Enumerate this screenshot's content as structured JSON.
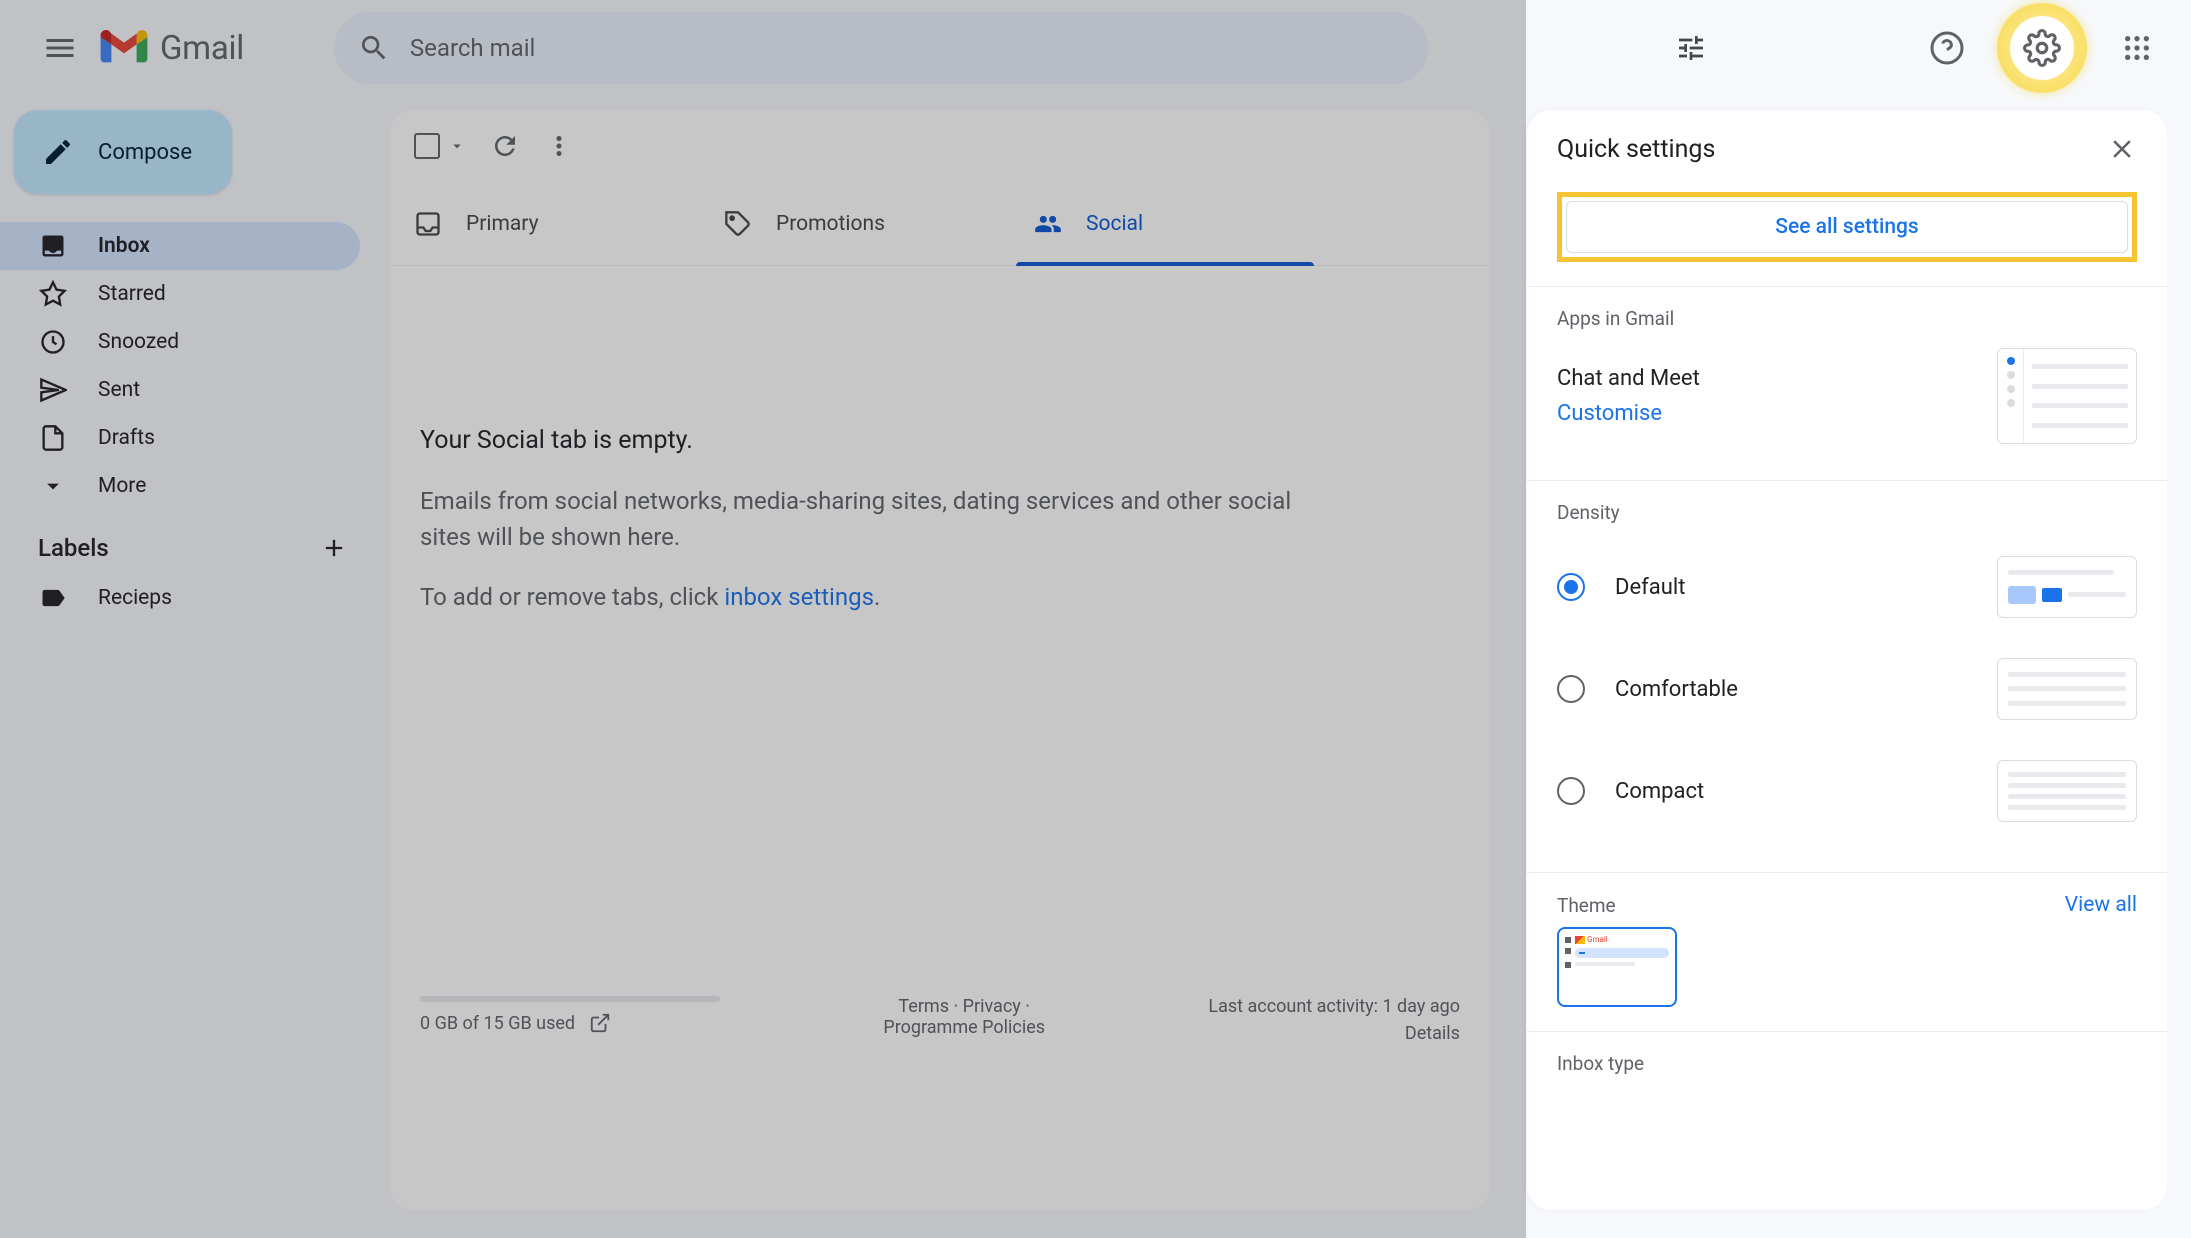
{
  "app": {
    "name": "Gmail"
  },
  "search": {
    "placeholder": "Search mail"
  },
  "compose": {
    "label": "Compose"
  },
  "sidebar": {
    "items": [
      {
        "label": "Inbox",
        "icon": "inbox-icon",
        "active": true
      },
      {
        "label": "Starred",
        "icon": "star-icon"
      },
      {
        "label": "Snoozed",
        "icon": "clock-icon"
      },
      {
        "label": "Sent",
        "icon": "send-icon"
      },
      {
        "label": "Drafts",
        "icon": "file-icon"
      },
      {
        "label": "More",
        "icon": "chevron-down-icon"
      }
    ],
    "labels_header": "Labels",
    "labels": [
      {
        "label": "Recieps",
        "icon": "tag-icon"
      }
    ]
  },
  "tabs": [
    {
      "label": "Primary",
      "icon": "inbox-icon"
    },
    {
      "label": "Promotions",
      "icon": "tag-icon"
    },
    {
      "label": "Social",
      "icon": "people-icon",
      "active": true
    }
  ],
  "empty": {
    "title": "Your Social tab is empty.",
    "desc": "Emails from social networks, media-sharing sites, dating services and other social sites will be shown here.",
    "hint_prefix": "To add or remove tabs, click ",
    "hint_link": "inbox settings",
    "hint_suffix": "."
  },
  "footer": {
    "storage": "0 GB of 15 GB used",
    "terms": "Terms",
    "privacy": "Privacy",
    "policies": "Programme Policies",
    "activity": "Last account activity: 1 day ago",
    "details": "Details"
  },
  "quick_settings": {
    "title": "Quick settings",
    "see_all": "See all settings",
    "apps_section": "Apps in Gmail",
    "chat_meet": "Chat and Meet",
    "customise": "Customise",
    "density_section": "Density",
    "density_options": [
      "Default",
      "Comfortable",
      "Compact"
    ],
    "density_selected": "Default",
    "theme_section": "Theme",
    "view_all": "View all",
    "inbox_type_section": "Inbox type"
  }
}
